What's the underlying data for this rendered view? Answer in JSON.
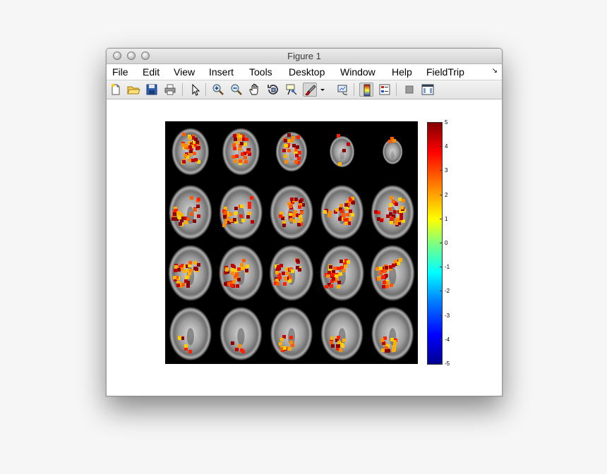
{
  "window": {
    "title": "Figure 1"
  },
  "menu": {
    "items": [
      "File",
      "Edit",
      "View",
      "Insert",
      "Tools",
      "Desktop",
      "Window",
      "Help",
      "FieldTrip"
    ],
    "overflow_icon": "corner-arrow-icon"
  },
  "toolbar": {
    "buttons": [
      {
        "name": "new-figure",
        "icon": "new-document-icon"
      },
      {
        "name": "open-file",
        "icon": "open-folder-icon"
      },
      {
        "name": "save-figure",
        "icon": "floppy-disk-icon"
      },
      {
        "name": "print-figure",
        "icon": "printer-icon"
      },
      {
        "name": "edit-plot",
        "icon": "pointer-arrow-icon"
      },
      {
        "name": "zoom-in",
        "icon": "zoom-in-icon"
      },
      {
        "name": "zoom-out",
        "icon": "zoom-out-icon"
      },
      {
        "name": "pan",
        "icon": "hand-icon"
      },
      {
        "name": "rotate-3d",
        "icon": "rotate-3d-icon"
      },
      {
        "name": "data-cursor",
        "icon": "data-cursor-icon"
      },
      {
        "name": "brush",
        "icon": "brush-icon"
      },
      {
        "name": "link-plot",
        "icon": "link-plot-icon"
      },
      {
        "name": "insert-colorbar",
        "icon": "colorbar-icon"
      },
      {
        "name": "insert-legend",
        "icon": "legend-icon"
      },
      {
        "name": "hide-plot-tools",
        "icon": "hide-tools-icon"
      },
      {
        "name": "show-plot-tools",
        "icon": "show-tools-icon"
      }
    ]
  },
  "figure": {
    "slices": {
      "rows": 4,
      "cols": 5
    },
    "colorbar": {
      "ticks": [
        "5",
        "4",
        "3",
        "2",
        "1",
        "0",
        "-1",
        "-2",
        "-3",
        "-4",
        "-5"
      ],
      "colormap": "jet",
      "range": [
        -5,
        5
      ]
    }
  }
}
